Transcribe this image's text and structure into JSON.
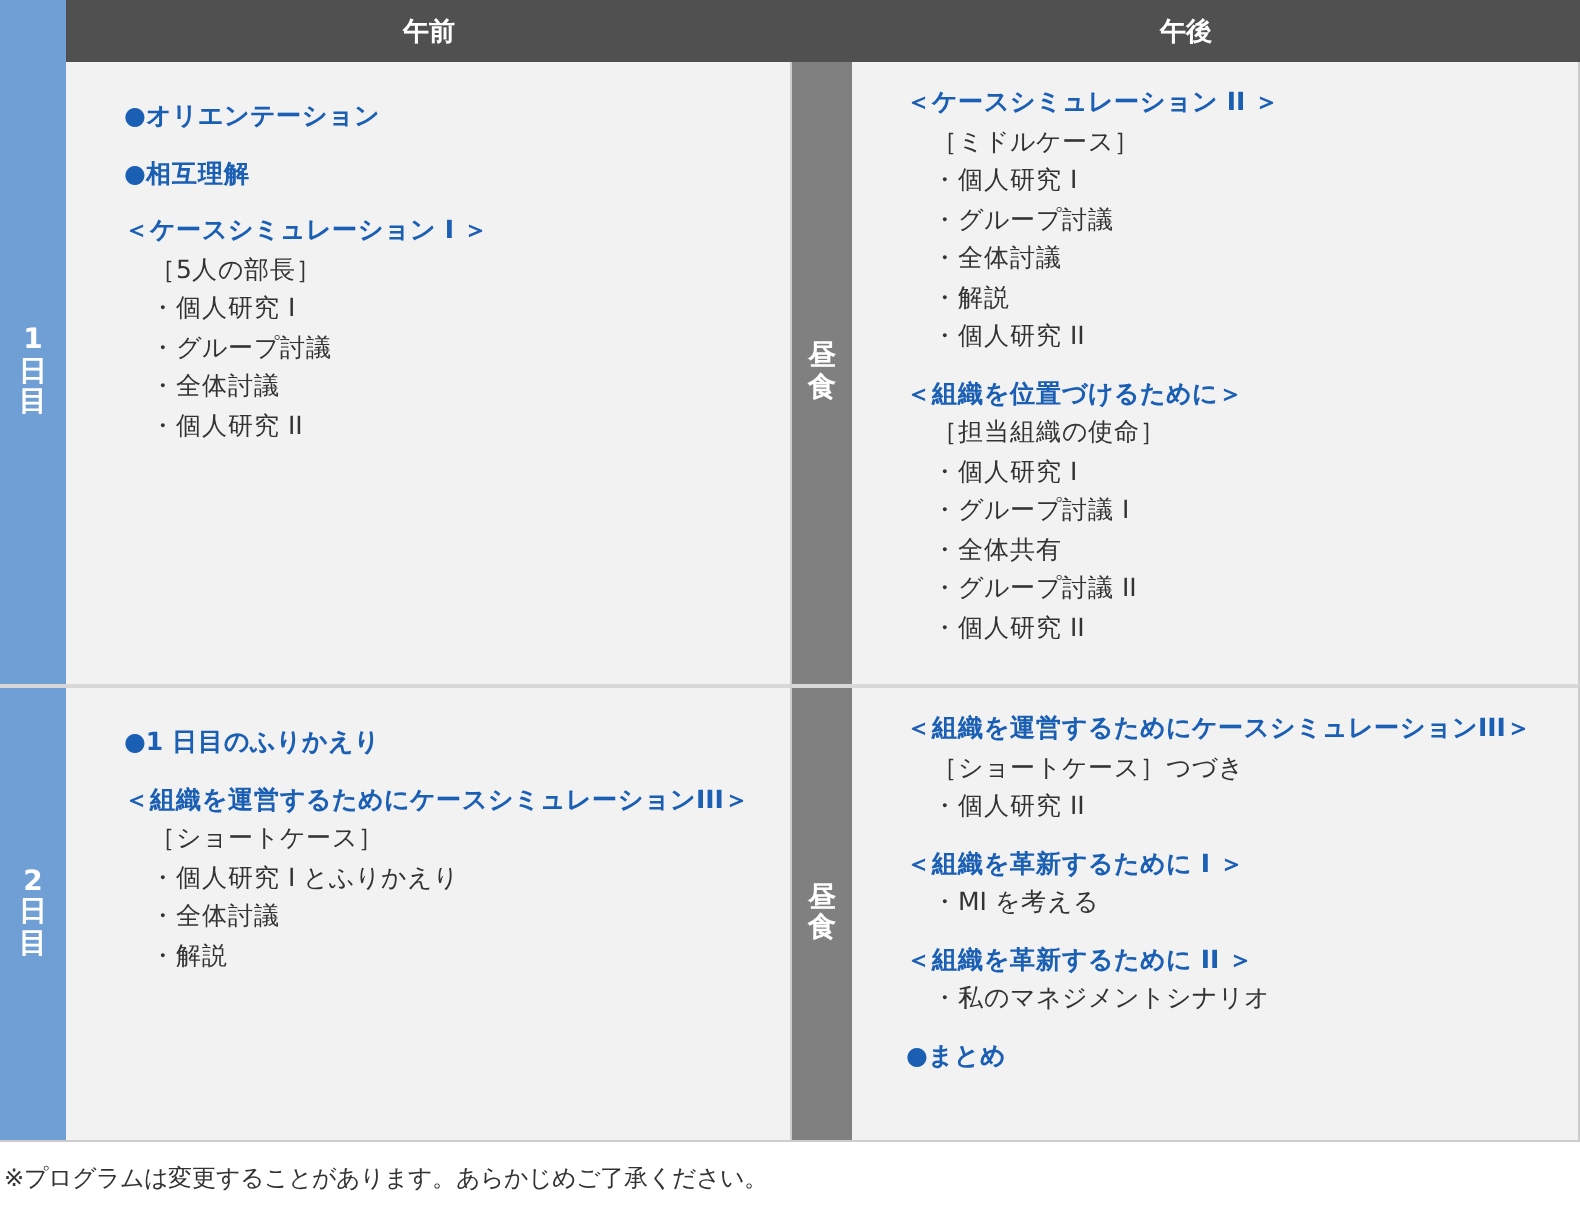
{
  "header": {
    "morning": "午前",
    "afternoon": "午後"
  },
  "days": [
    {
      "day": "1日目",
      "lunch": "昼食",
      "morning": [
        {
          "kind": "point",
          "text": "●オリエンテーション"
        },
        {
          "kind": "point",
          "text": "●相互理解"
        },
        {
          "kind": "heading",
          "text": "＜ケースシミュレーション I ＞"
        },
        {
          "kind": "note",
          "text": "［5人の部長］"
        },
        {
          "kind": "item",
          "text": "・個人研究 I"
        },
        {
          "kind": "item",
          "text": "・グループ討議"
        },
        {
          "kind": "item",
          "text": "・全体討議"
        },
        {
          "kind": "item",
          "text": "・個人研究 II"
        }
      ],
      "afternoon": [
        {
          "kind": "heading",
          "text": "＜ケースシミュレーション II ＞"
        },
        {
          "kind": "note",
          "text": "［ミドルケース］"
        },
        {
          "kind": "item",
          "text": "・個人研究 I"
        },
        {
          "kind": "item",
          "text": "・グループ討議"
        },
        {
          "kind": "item",
          "text": "・全体討議"
        },
        {
          "kind": "item",
          "text": "・解説"
        },
        {
          "kind": "item",
          "text": "・個人研究 II"
        },
        {
          "kind": "heading",
          "text": "＜組織を位置づけるために＞"
        },
        {
          "kind": "note",
          "text": "［担当組織の使命］"
        },
        {
          "kind": "item",
          "text": "・個人研究 I"
        },
        {
          "kind": "item",
          "text": "・グループ討議 I"
        },
        {
          "kind": "item",
          "text": "・全体共有"
        },
        {
          "kind": "item",
          "text": "・グループ討議 II"
        },
        {
          "kind": "item",
          "text": "・個人研究 II"
        }
      ]
    },
    {
      "day": "2日目",
      "lunch": "昼食",
      "morning": [
        {
          "kind": "point",
          "text": "●1 日目のふりかえり"
        },
        {
          "kind": "heading",
          "text": "＜組織を運営するためにケースシミュレーションIII＞"
        },
        {
          "kind": "note",
          "text": "［ショートケース］"
        },
        {
          "kind": "item",
          "text": "・個人研究 I とふりかえり"
        },
        {
          "kind": "item",
          "text": "・全体討議"
        },
        {
          "kind": "item",
          "text": "・解説"
        }
      ],
      "afternoon": [
        {
          "kind": "heading",
          "text": "＜組織を運営するためにケースシミュレーションIII＞"
        },
        {
          "kind": "note",
          "text": "［ショートケース］つづき"
        },
        {
          "kind": "item",
          "text": "・個人研究 II"
        },
        {
          "kind": "heading",
          "text": "＜組織を革新するために I ＞"
        },
        {
          "kind": "item",
          "text": "・MI を考える"
        },
        {
          "kind": "heading",
          "text": "＜組織を革新するために II ＞"
        },
        {
          "kind": "item",
          "text": "・私のマネジメントシナリオ"
        },
        {
          "kind": "point",
          "text": "●まとめ"
        }
      ]
    }
  ],
  "footnote": "※プログラムは変更することがあります。あらかじめご了承ください。"
}
